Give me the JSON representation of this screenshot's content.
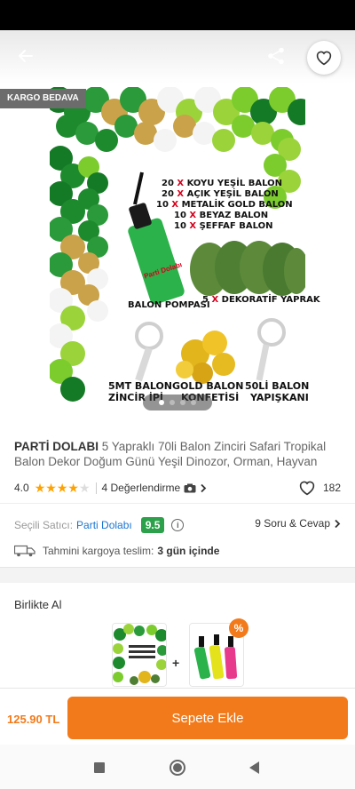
{
  "hero": {
    "cargo_badge": "KARGO BEDAVA",
    "image_lines": {
      "l1_count": "20",
      "l1_text": "KOYU YEŞİL BALON",
      "l2_count": "20",
      "l2_text": "AÇIK YEŞİL BALON",
      "l3_count": "10",
      "l3_text": "METALİK GOLD BALON",
      "l4_count": "10",
      "l4_text": "BEYAZ BALON",
      "l5_count": "10",
      "l5_text": "ŞEFFAF BALON",
      "x_mark": "X",
      "pump": "BALON POMPASI",
      "leaves_count": "5",
      "leaves_text": "DEKORATİF YAPRAK",
      "chain_1": "5MT BALON",
      "chain_2": "ZİNCİR İPİ",
      "confetti_1": "GOLD BALON",
      "confetti_2": "KONFETİSİ",
      "glue_1": "50Lİ BALON",
      "glue_2": "YAPIŞKANI",
      "pump_brand": "Parti Dolabı"
    },
    "slides": 4,
    "active_slide": 1
  },
  "product": {
    "brand": "PARTİ DOLABI",
    "title": " 5 Yapraklı 70li Balon Zinciri Safari Tropikal Balon Dekor Doğum Günü Yeşil Dinozor, Orman, Hayvan",
    "rating": "4.0",
    "rating_value": 4,
    "reviews": "4 Değerlendirme",
    "favorites": "182"
  },
  "seller": {
    "label": "Seçili Satıcı:",
    "name": "Parti Dolabı",
    "score": "9.5",
    "qa": "9 Soru & Cevap"
  },
  "delivery": {
    "label": "Tahmini kargoya teslim:",
    "value": "3 gün içinde"
  },
  "bundle": {
    "title": "Birlikte Al",
    "plus": "+",
    "discount_icon": "%"
  },
  "cart": {
    "price": "125.90 TL",
    "button": "Sepete Ekle"
  },
  "colors": {
    "accent": "#f27a1a",
    "seller_link": "#1b75d0",
    "score_green": "#2ca04a",
    "star": "#ffa200"
  }
}
